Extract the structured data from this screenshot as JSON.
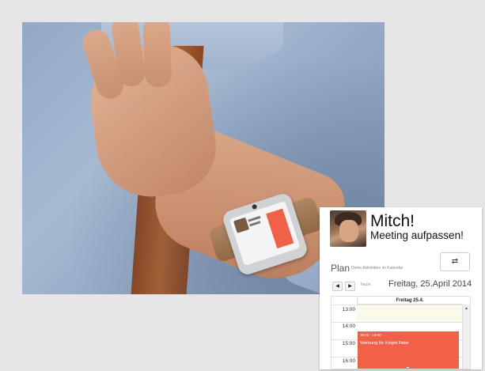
{
  "notification": {
    "name": "Mitch!",
    "message": "Meeting aufpassen!"
  },
  "plan": {
    "title": "Plan",
    "subtitle": "Deine Aktivitäten im Kalendar",
    "toggle_icon": "⇄"
  },
  "navigation": {
    "prev_icon": "◀",
    "next_icon": "▶",
    "today_label": "heute",
    "current_date": "Freitag, 25.April 2014"
  },
  "calendar": {
    "day_header": "Freitag 25.4.",
    "times": [
      "13:00",
      "14:00",
      "15:00",
      "16:00"
    ],
    "event": {
      "time": "15:00 - 16:00",
      "title": "Werbung für Knight Rider",
      "color": "#f26047"
    },
    "scroll_icon": "▲"
  },
  "colors": {
    "accent": "#f26047",
    "background": "#e6e6e6"
  }
}
